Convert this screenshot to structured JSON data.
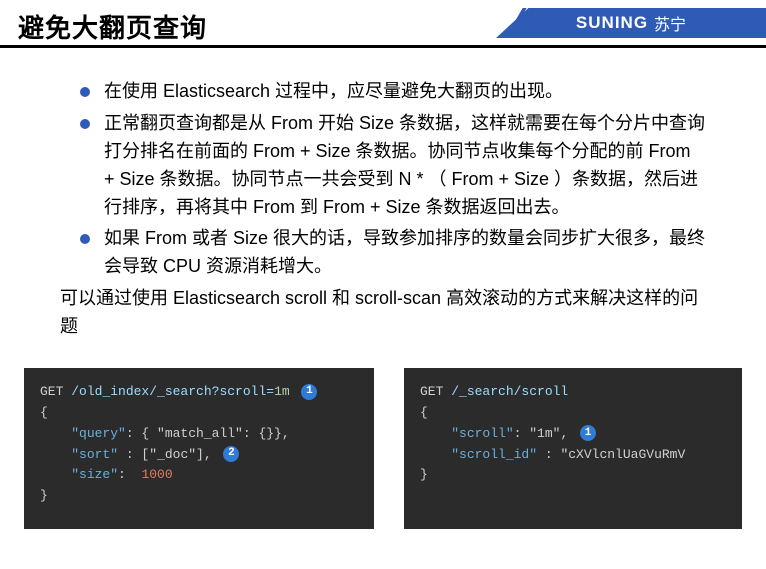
{
  "header": {
    "title": "避免大翻页查询",
    "brand_en": "SUNING",
    "brand_cn": "苏宁"
  },
  "bullets": [
    "在使用 Elasticsearch 过程中，应尽量避免大翻页的出现。",
    "正常翻页查询都是从 From 开始 Size 条数据，这样就需要在每个分片中查询打分排名在前面的 From + Size 条数据。协同节点收集每个分配的前 From + Size 条数据。协同节点一共会受到 N * （ From + Size ）条数据，然后进行排序，再将其中 From 到 From + Size 条数据返回出去。",
    "如果 From 或者 Size 很大的话，导致参加排序的数量会同步扩大很多，最终会导致 CPU 资源消耗增大。"
  ],
  "followup": "可以通过使用 Elasticsearch scroll 和 scroll-scan 高效滚动的方式来解决这样的问题",
  "code_left": {
    "line1_pre": "GET ",
    "line1_path": "/old_index/_search?scroll=",
    "line1_param": "1m",
    "badge1": "1",
    "line2": "{",
    "line3_key": "\"query\"",
    "line3_val": ": { \"match_all\": {}},",
    "line4_key": "\"sort\"",
    "line4_val": " : [\"_doc\"], ",
    "badge2": "2",
    "line5_key": "\"size\"",
    "line5_colon": ":  ",
    "line5_num": "1000",
    "line6": "}"
  },
  "code_right": {
    "line1_pre": "GET ",
    "line1_path": "/_search/scroll",
    "line2": "{",
    "line3_key": "\"scroll\"",
    "line3_val": ": \"1m\", ",
    "badge1": "1",
    "line4_key": "\"scroll_id\"",
    "line4_val": " : \"cXVlcnlUaGVuRmV",
    "line5": "}"
  }
}
